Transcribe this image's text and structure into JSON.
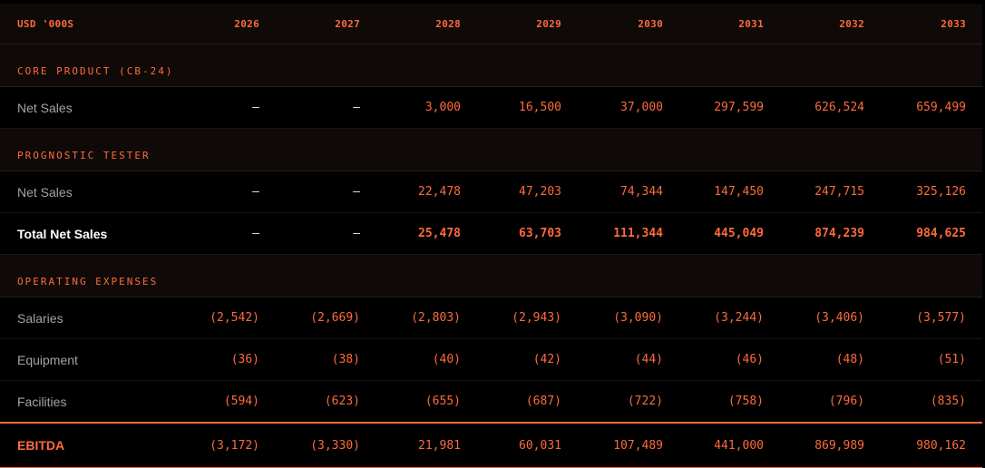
{
  "header": {
    "label": "USD '000S",
    "years": [
      "2026",
      "2027",
      "2028",
      "2029",
      "2030",
      "2031",
      "2032",
      "2033"
    ]
  },
  "sections": {
    "core_product": {
      "title": "CORE PRODUCT (CB-24)",
      "net_sales": {
        "label": "Net Sales",
        "values": [
          "—",
          "—",
          "3,000",
          "16,500",
          "37,000",
          "297,599",
          "626,524",
          "659,499"
        ]
      }
    },
    "prognostic_tester": {
      "title": "PROGNOSTIC TESTER",
      "net_sales": {
        "label": "Net Sales",
        "values": [
          "—",
          "—",
          "22,478",
          "47,203",
          "74,344",
          "147,450",
          "247,715",
          "325,126"
        ]
      },
      "total_net_sales": {
        "label": "Total Net Sales",
        "values": [
          "—",
          "—",
          "25,478",
          "63,703",
          "111,344",
          "445,049",
          "874,239",
          "984,625"
        ]
      }
    },
    "operating_expenses": {
      "title": "OPERATING EXPENSES",
      "salaries": {
        "label": "Salaries",
        "values": [
          "(2,542)",
          "(2,669)",
          "(2,803)",
          "(2,943)",
          "(3,090)",
          "(3,244)",
          "(3,406)",
          "(3,577)"
        ]
      },
      "equipment": {
        "label": "Equipment",
        "values": [
          "(36)",
          "(38)",
          "(40)",
          "(42)",
          "(44)",
          "(46)",
          "(48)",
          "(51)"
        ]
      },
      "facilities": {
        "label": "Facilities",
        "values": [
          "(594)",
          "(623)",
          "(655)",
          "(687)",
          "(722)",
          "(758)",
          "(796)",
          "(835)"
        ]
      }
    }
  },
  "ebitda": {
    "label": "EBITDA",
    "values": [
      "(3,172)",
      "(3,330)",
      "21,981",
      "60,031",
      "107,489",
      "441,000",
      "869,989",
      "980,162"
    ]
  },
  "colors": {
    "accent": "#ff6a3d",
    "background": "#000000",
    "header_bg": "#0f0a08"
  }
}
